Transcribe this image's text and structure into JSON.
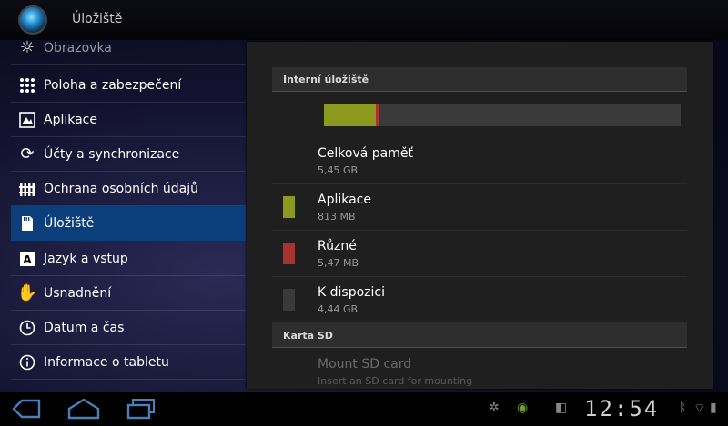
{
  "header": {
    "title": "Úložiště"
  },
  "sidebar": {
    "items": [
      {
        "label": "Obrazovka",
        "icon": "display-icon"
      },
      {
        "label": "Poloha a zabezpečení",
        "icon": "location-security-icon"
      },
      {
        "label": "Aplikace",
        "icon": "apps-icon"
      },
      {
        "label": "Účty a synchronizace",
        "icon": "sync-icon"
      },
      {
        "label": "Ochrana osobních údajů",
        "icon": "privacy-icon"
      },
      {
        "label": "Úložiště",
        "icon": "storage-icon",
        "selected": true
      },
      {
        "label": "Jazyk a vstup",
        "icon": "language-icon"
      },
      {
        "label": "Usnadnění",
        "icon": "accessibility-icon"
      },
      {
        "label": "Datum a čas",
        "icon": "clock-icon"
      },
      {
        "label": "Informace o tabletu",
        "icon": "info-icon"
      }
    ]
  },
  "storage": {
    "internal_header": "Interní úložiště",
    "usage": {
      "apps_fraction": 0.146,
      "misc_fraction": 0.01
    },
    "colors": {
      "apps": "#8b9a1f",
      "misc": "#a83232",
      "free": "#3a3a3a"
    },
    "total": {
      "title": "Celková paměť",
      "value": "5,45 GB"
    },
    "apps": {
      "title": "Aplikace",
      "value": "813 MB"
    },
    "misc": {
      "title": "Různé",
      "value": "5,47 MB"
    },
    "free": {
      "title": "K dispozici",
      "value": "4,44 GB"
    },
    "sd_header": "Karta SD",
    "mount": {
      "title": "Mount SD card",
      "value": "Insert an SD card for mounting"
    }
  },
  "system_bar": {
    "clock": "12:54"
  }
}
